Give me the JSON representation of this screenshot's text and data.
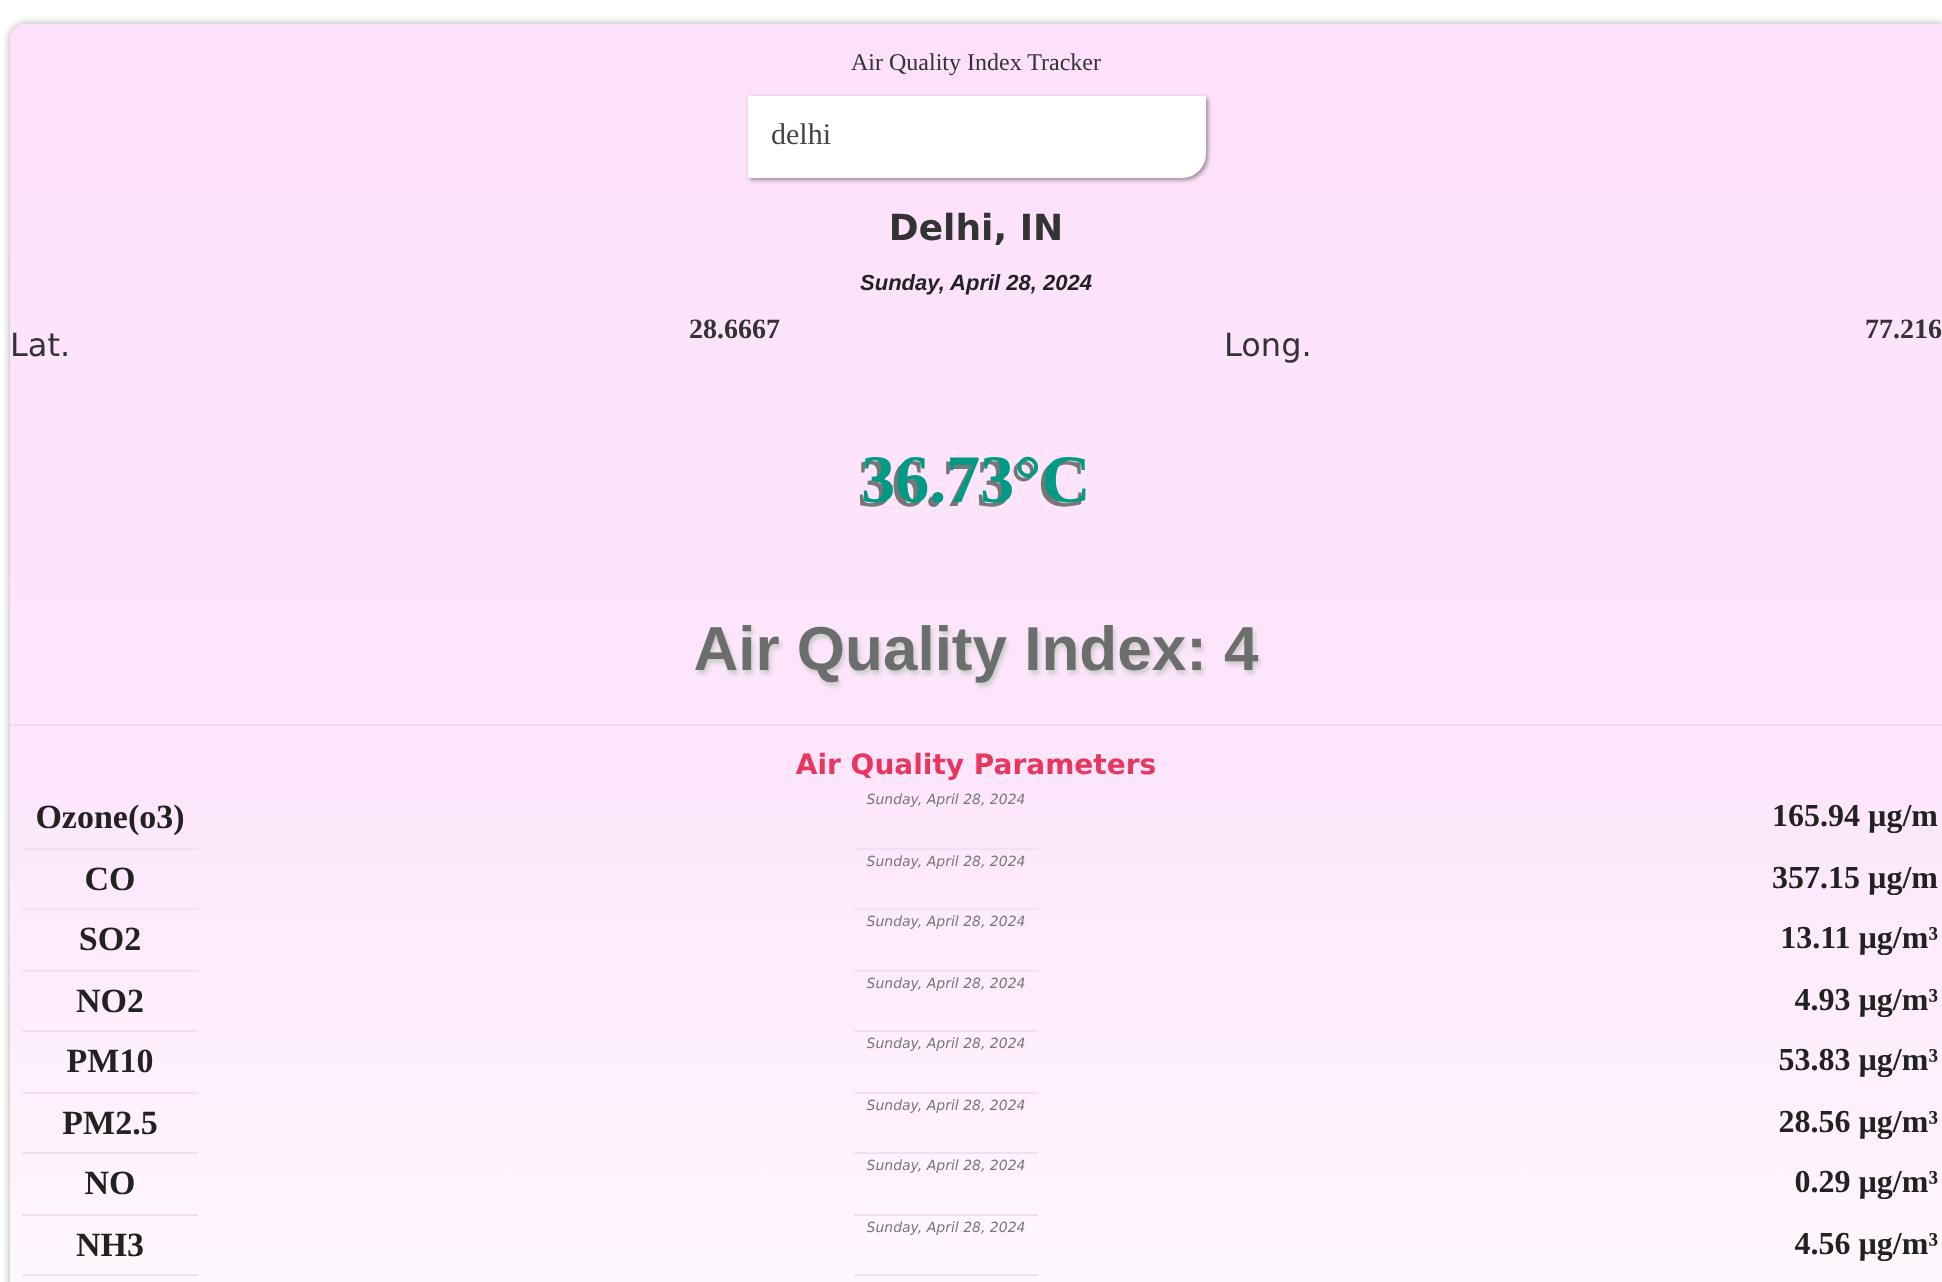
{
  "app_title": "Air Quality Index Tracker",
  "search": {
    "value": "delhi"
  },
  "city": "Delhi, IN",
  "date": "Sunday, April 28, 2024",
  "coordinates": {
    "lat_label": "Lat.",
    "lat_value": "28.6667",
    "long_label": "Long.",
    "long_value": "77.216"
  },
  "temperature": "36.73°C",
  "aqi": "Air Quality Index: 4",
  "parameters": {
    "title": "Air Quality Parameters",
    "rows": [
      {
        "name": "Ozone(o3)",
        "date": "Sunday, April 28, 2024",
        "value": "165.94 µg/m"
      },
      {
        "name": "CO",
        "date": "Sunday, April 28, 2024",
        "value": "357.15 µg/m"
      },
      {
        "name": "SO2",
        "date": "Sunday, April 28, 2024",
        "value": "13.11 µg/m³"
      },
      {
        "name": "NO2",
        "date": "Sunday, April 28, 2024",
        "value": "4.93 µg/m³"
      },
      {
        "name": "PM10",
        "date": "Sunday, April 28, 2024",
        "value": "53.83 µg/m³"
      },
      {
        "name": "PM2.5",
        "date": "Sunday, April 28, 2024",
        "value": "28.56 µg/m³"
      },
      {
        "name": "NO",
        "date": "Sunday, April 28, 2024",
        "value": "0.29 µg/m³"
      },
      {
        "name": "NH3",
        "date": "Sunday, April 28, 2024",
        "value": "4.56 µg/m³"
      }
    ]
  }
}
